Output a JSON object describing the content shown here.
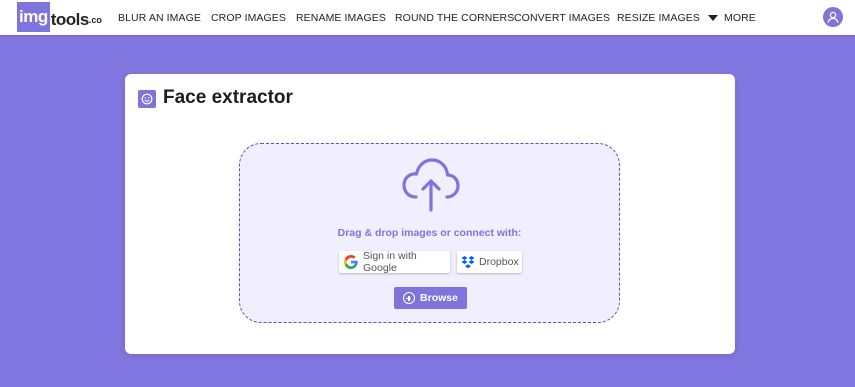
{
  "header": {
    "logo_main": "img",
    "logo_tools": "tools",
    "logo_co": ".co",
    "nav": [
      {
        "label": "BLUR AN IMAGE"
      },
      {
        "label": "CROP IMAGES"
      },
      {
        "label": "RENAME IMAGES"
      },
      {
        "label": "ROUND THE CORNERS"
      },
      {
        "label": "CONVERT IMAGES"
      },
      {
        "label": "RESIZE IMAGES"
      }
    ],
    "more_label": "MORE",
    "icons": {
      "avatar": "user-icon",
      "more": "caret-down-icon"
    }
  },
  "main": {
    "title": "Face extractor",
    "title_icon": "face-icon",
    "upload_icon": "cloud-upload-icon",
    "drag_text": "Drag & drop images or connect with:",
    "google_label": "Sign in with Google",
    "dropbox_label": "Dropbox",
    "browse_label": "Browse",
    "icons": {
      "google": "google-icon",
      "dropbox": "dropbox-icon",
      "browse": "plus-circle-icon"
    }
  },
  "colors": {
    "background": "#8277e0",
    "accent": "#7f73dc",
    "dropzone_bg": "#f1efff",
    "dropzone_border": "#5a4fc4"
  }
}
